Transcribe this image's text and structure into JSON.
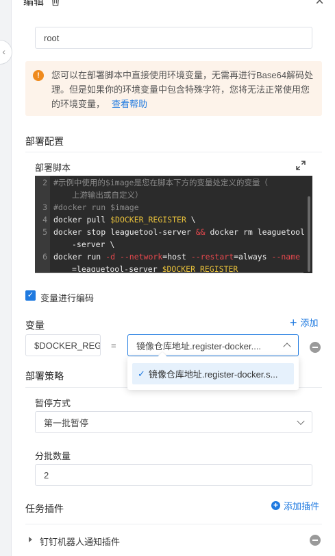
{
  "header": {
    "title": "编辑"
  },
  "form": {
    "top_input_value": "root",
    "alert": {
      "text": "您可以在部署脚本中直接使用环境变量，无需再进行Base64解码处理。但是如果你的环境变量中包含特殊字符，您将无法正常使用您的环境变量，",
      "link": "查看帮助"
    },
    "deploy_config": {
      "title": "部署配置",
      "script_label": "部署脚本",
      "script_lines": [
        {
          "num": "2",
          "text": "#示例中使用的$image是您在脚本下方的变量处定义的变量（"
        },
        {
          "num": "",
          "text": "上游输出或自定义）"
        },
        {
          "num": "3",
          "text": "#docker run $image"
        },
        {
          "num": "4",
          "text": "docker pull $DOCKER_REGISTER \\"
        },
        {
          "num": "5",
          "text": "docker stop leaguetool-server && docker rm leaguetool"
        },
        {
          "num": "",
          "text": "-server \\"
        },
        {
          "num": "6",
          "text": "docker run -d --network=host --restart=always --name"
        },
        {
          "num": "",
          "text": "=leaguetool-server $DOCKER_REGISTER"
        }
      ],
      "encode_checkbox_label": "变量进行编码",
      "encode_checked": true
    },
    "variables": {
      "title": "变量",
      "add_label": "添加",
      "name_value": "$DOCKER_REGISTER",
      "equals": "=",
      "selected_value": "镜像仓库地址.register-docker....",
      "dropdown_option": "镜像仓库地址.register-docker.s..."
    },
    "strategy": {
      "title": "部署策略",
      "pause_label": "暂停方式",
      "pause_value": "第一批暂停",
      "batch_label": "分批数量",
      "batch_value": "2"
    },
    "plugins": {
      "title": "任务插件",
      "add_label": "添加插件",
      "items": [
        {
          "label": "钉钉机器人通知插件"
        }
      ]
    }
  },
  "colors": {
    "accent": "#1f7ae0",
    "warning": "#ef8a1d",
    "alert_bg": "#fdf3ea",
    "code_bg": "#2b2b2b"
  }
}
